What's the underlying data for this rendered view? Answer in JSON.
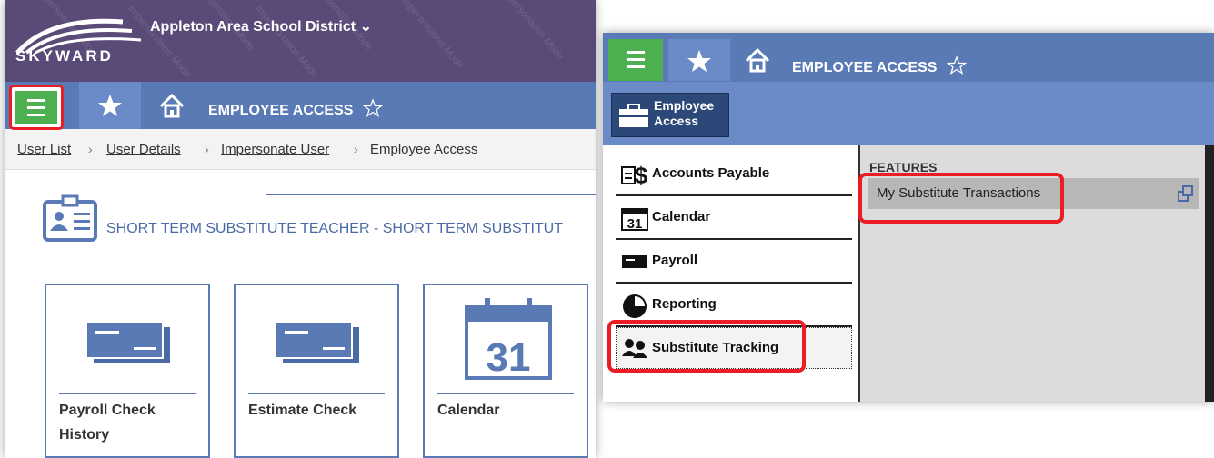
{
  "left": {
    "district": "Appleton Area School District",
    "logo_text": "SKYWARD",
    "watermark": "Impersonation Mode",
    "header_title": "EMPLOYEE ACCESS",
    "breadcrumb": [
      {
        "label": "User List"
      },
      {
        "label": "User Details"
      },
      {
        "label": "Impersonate User"
      },
      {
        "label": "Employee Access"
      }
    ],
    "role": "SHORT TERM SUBSTITUTE TEACHER - SHORT TERM SUBSTITUT",
    "tiles": [
      {
        "label": "Payroll Check History",
        "icon": "check-icon"
      },
      {
        "label": "Estimate Check",
        "icon": "check-icon"
      },
      {
        "label": "Calendar",
        "icon": "calendar-icon",
        "icon_text": "31"
      }
    ]
  },
  "right": {
    "header_title": "EMPLOYEE ACCESS",
    "employee_access_button": "Employee Access",
    "menu": [
      {
        "label": "Accounts Payable",
        "icon": "accounts-payable-icon"
      },
      {
        "label": "Calendar",
        "icon": "calendar-icon",
        "icon_text": "31"
      },
      {
        "label": "Payroll",
        "icon": "payroll-icon"
      },
      {
        "label": "Reporting",
        "icon": "reporting-icon"
      },
      {
        "label": "Substitute Tracking",
        "icon": "substitute-icon"
      }
    ],
    "features_title": "FEATURES",
    "features": [
      {
        "label": "My Substitute Transactions"
      }
    ]
  },
  "colors": {
    "header_purple": "#5a4a78",
    "nav_blue": "#5a7ab5",
    "menu_green": "#4caf50",
    "highlight_red": "#ec1c24"
  }
}
